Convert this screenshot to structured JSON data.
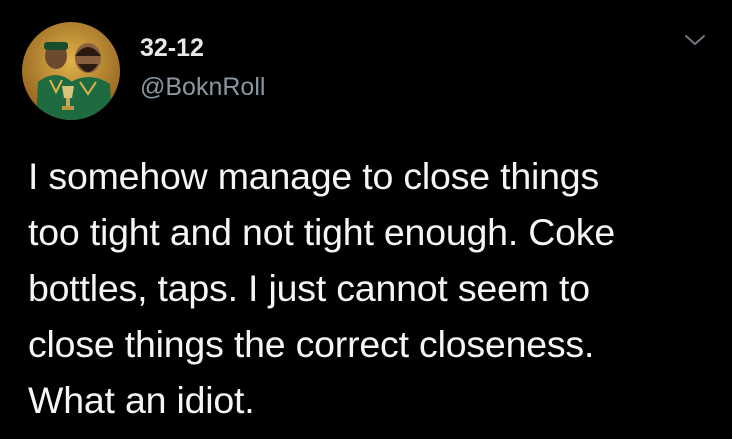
{
  "tweet": {
    "display_name": "32-12",
    "handle": "@BoknRoll",
    "text": "I somehow manage to close things\ntoo tight and not tight enough. Coke\nbottles, taps. I just cannot seem to\nclose things the correct closeness.\nWhat an idiot.",
    "avatar_icon": "profile-photo",
    "menu_icon": "chevron-down-icon"
  },
  "colors": {
    "background": "#000000",
    "name": "#e8e8e8",
    "handle": "#8a96a2",
    "text": "#f5f5f5",
    "avatar_bg": "#b8862f",
    "jersey": "#1d6b3e"
  }
}
